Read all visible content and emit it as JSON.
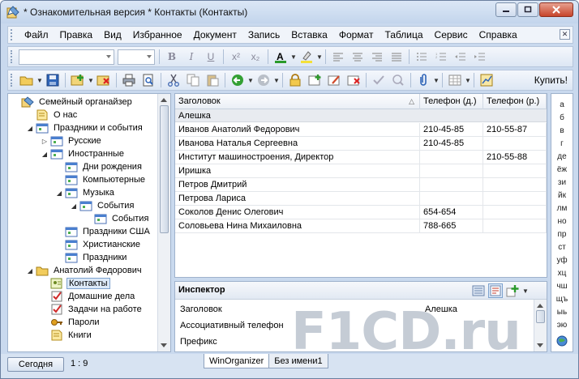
{
  "window": {
    "title": "* Ознакомительная версия * Контакты (Контакты)"
  },
  "menu": [
    "Файл",
    "Правка",
    "Вид",
    "Избранное",
    "Документ",
    "Запись",
    "Вставка",
    "Формат",
    "Таблица",
    "Сервис",
    "Справка"
  ],
  "toolbar": {
    "buy_label": "Купить!"
  },
  "tree": [
    {
      "label": "Семейный органайзер",
      "level": 0,
      "exp": "",
      "icon": "organizer-icon"
    },
    {
      "label": "О нас",
      "level": 1,
      "exp": "",
      "icon": "note-icon"
    },
    {
      "label": "Праздники и события",
      "level": 1,
      "exp": "◢",
      "icon": "calendar-icon"
    },
    {
      "label": "Русские",
      "level": 2,
      "exp": "▷",
      "icon": "calendar-icon"
    },
    {
      "label": "Иностранные",
      "level": 2,
      "exp": "◢",
      "icon": "calendar-icon"
    },
    {
      "label": "Дни рождения",
      "level": 3,
      "exp": "",
      "icon": "calendar-icon"
    },
    {
      "label": "Компьютерные",
      "level": 3,
      "exp": "",
      "icon": "calendar-icon"
    },
    {
      "label": "Музыка",
      "level": 3,
      "exp": "◢",
      "icon": "calendar-icon"
    },
    {
      "label": "События",
      "level": 4,
      "exp": "◢",
      "icon": "calendar-icon"
    },
    {
      "label": "События",
      "level": 5,
      "exp": "",
      "icon": "calendar-icon"
    },
    {
      "label": "Праздники США",
      "level": 3,
      "exp": "",
      "icon": "calendar-icon"
    },
    {
      "label": "Христианские",
      "level": 3,
      "exp": "",
      "icon": "calendar-icon"
    },
    {
      "label": "Праздники",
      "level": 3,
      "exp": "",
      "icon": "calendar-icon"
    },
    {
      "label": "Анатолий Федорович",
      "level": 1,
      "exp": "◢",
      "icon": "folder-icon"
    },
    {
      "label": "Контакты",
      "level": 2,
      "exp": "",
      "icon": "contacts-icon",
      "selected": true
    },
    {
      "label": "Домашние дела",
      "level": 2,
      "exp": "",
      "icon": "tasks-icon"
    },
    {
      "label": "Задачи на работе",
      "level": 2,
      "exp": "",
      "icon": "tasks-icon"
    },
    {
      "label": "Пароли",
      "level": 2,
      "exp": "",
      "icon": "key-icon"
    },
    {
      "label": "Книги",
      "level": 2,
      "exp": "",
      "icon": "note-icon"
    }
  ],
  "grid": {
    "columns": [
      "Заголовок",
      "Телефон (д.)",
      "Телефон (р.)"
    ],
    "group": "Алешка",
    "rows": [
      [
        "Иванов Анатолий Федорович",
        "210-45-85",
        "210-55-87"
      ],
      [
        "Иванова Наталья Сергеевна",
        "210-45-85",
        ""
      ],
      [
        "Институт машиностроения, Директор",
        "",
        "210-55-88"
      ],
      [
        "Иришка",
        "",
        ""
      ],
      [
        "Петров Дмитрий",
        "",
        ""
      ],
      [
        "Петрова Лариса",
        "",
        ""
      ],
      [
        "Соколов Денис Олегович",
        "654-654",
        ""
      ],
      [
        "Соловьева Нина Михаиловна",
        "788-665",
        ""
      ]
    ]
  },
  "inspector": {
    "title": "Инспектор",
    "rows": [
      {
        "key": "Заголовок",
        "value": "Алешка"
      },
      {
        "key": "Ассоциативный телефон",
        "value": ""
      },
      {
        "key": "Префикс",
        "value": ""
      }
    ]
  },
  "alphabet": [
    "а",
    "б",
    "в",
    "г",
    "де",
    "ёж",
    "зи",
    "йк",
    "лм",
    "но",
    "пр",
    "ст",
    "уф",
    "хц",
    "чш",
    "щъ",
    "ыь",
    "эю"
  ],
  "status": {
    "today_label": "Сегодня",
    "position": "1 : 9",
    "tabs": [
      "WinOrganizer",
      "Без имени1"
    ]
  },
  "watermark": "F1CD.ru",
  "colors": {
    "frame": "#c9d9ee",
    "selection": "#dce9f8",
    "group_row": "#e8ebf0"
  }
}
